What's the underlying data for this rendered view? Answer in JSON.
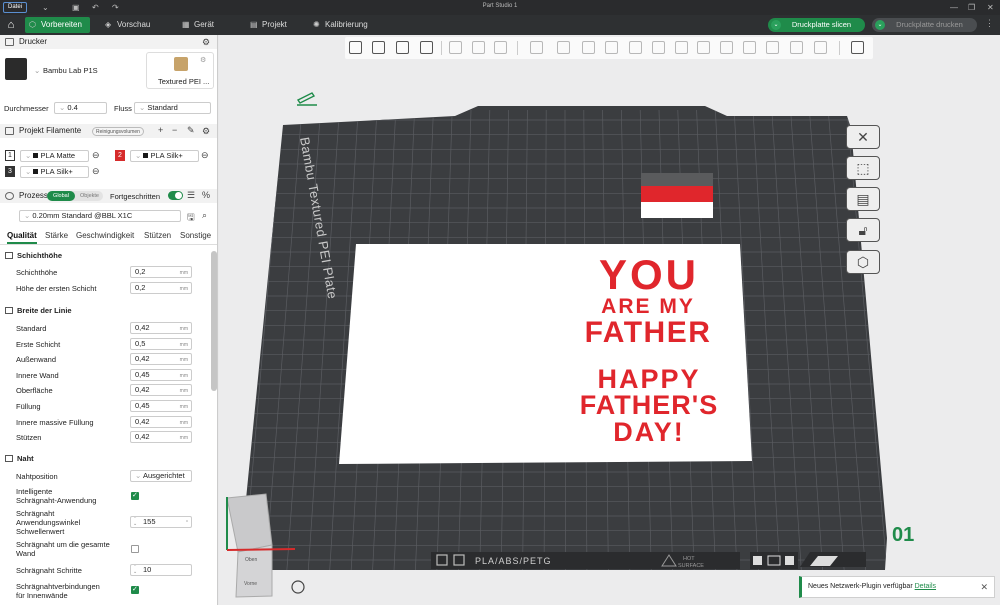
{
  "titlebar": {
    "file_menu": "Datei",
    "window_title": "Part Studio 1"
  },
  "nav": {
    "tabs": [
      {
        "label": "Vorbereiten",
        "active": true
      },
      {
        "label": "Vorschau",
        "active": false
      },
      {
        "label": "Gerät",
        "active": false
      },
      {
        "label": "Projekt",
        "active": false
      },
      {
        "label": "Kalibrierung",
        "active": false
      }
    ],
    "slice_button": "Druckplatte slicen",
    "print_button": "Druckplatte drucken",
    "accent_color": "#1f8b4a"
  },
  "sidebar": {
    "printer": {
      "section_title": "Drucker",
      "printer_name": "Bambu Lab P1S",
      "plate_name": "Textured PEI ...",
      "diameter_label": "Durchmesser",
      "diameter_value": "0.4",
      "flow_label": "Fluss",
      "flow_value": "Standard"
    },
    "filaments": {
      "section_title": "Projekt Filamente",
      "purge_badge": "Reinigungsvolumen",
      "items": [
        {
          "slot": "1",
          "name": "PLA Matte",
          "color": "#1a1a1a"
        },
        {
          "slot": "2",
          "name": "PLA Silk+",
          "color": "#d62b2b"
        },
        {
          "slot": "3",
          "name": "PLA Silk+",
          "color": "#1a1a1a"
        }
      ]
    },
    "process": {
      "section_title": "Prozess",
      "toggle_global": "Global",
      "toggle_object": "Objekte",
      "advanced_label": "Fortgeschritten",
      "preset": "0.20mm Standard @BBL X1C",
      "tabs": [
        "Qualität",
        "Stärke",
        "Geschwindigkeit",
        "Stützen",
        "Sonstige"
      ]
    },
    "groups": {
      "layer_height": {
        "title": "Schichthöhe",
        "rows": [
          {
            "label": "Schichthöhe",
            "value": "0,2",
            "unit": "mm"
          },
          {
            "label": "Höhe der ersten Schicht",
            "value": "0,2",
            "unit": "mm"
          }
        ]
      },
      "line_width": {
        "title": "Breite der Linie",
        "rows": [
          {
            "label": "Standard",
            "value": "0,42",
            "unit": "mm"
          },
          {
            "label": "Erste Schicht",
            "value": "0,5",
            "unit": "mm"
          },
          {
            "label": "Außenwand",
            "value": "0,42",
            "unit": "mm"
          },
          {
            "label": "Innere Wand",
            "value": "0,45",
            "unit": "mm"
          },
          {
            "label": "Oberfläche",
            "value": "0,42",
            "unit": "mm"
          },
          {
            "label": "Füllung",
            "value": "0,45",
            "unit": "mm"
          },
          {
            "label": "Innere massive Füllung",
            "value": "0,42",
            "unit": "mm"
          },
          {
            "label": "Stützen",
            "value": "0,42",
            "unit": "mm"
          }
        ]
      },
      "seam": {
        "title": "Naht",
        "position_label": "Nahtposition",
        "position_value": "Ausgerichtet",
        "smart_label_1": "Intelligente",
        "smart_label_2": "Schrägnaht-Anwendung",
        "angle_label_1": "Schrägnaht",
        "angle_label_2": "Anwendungswinkel",
        "angle_label_3": "Schwellenwert",
        "angle_value": "155",
        "angle_unit": "°",
        "whole_wall_label_1": "Schrägnaht um die gesamte",
        "whole_wall_label_2": "Wand",
        "steps_label": "Schrägnaht Schritte",
        "steps_value": "10",
        "inner_label_1": "Schrägnahtverbindungen",
        "inner_label_2": "für Innenwände"
      }
    }
  },
  "viewport": {
    "plate_label": "Bambu Textured PEI Plate",
    "plate_number": "01",
    "plate_bottom_text": "PLA/ABS/PETG",
    "hot_surface_1": "HOT",
    "hot_surface_2": "SURFACE",
    "model_text": {
      "line1": "YOU",
      "line2": "ARE MY",
      "line3": "FATHER",
      "line4": "HAPPY",
      "line5": "FATHER'S",
      "line6": "DAY!"
    },
    "model_text_color": "#e0262c",
    "view_cube_top": "Oben",
    "view_cube_front": "Vorne"
  },
  "notification": {
    "text": "Neues Netzwerk-Plugin verfügbar",
    "link": "Details"
  }
}
